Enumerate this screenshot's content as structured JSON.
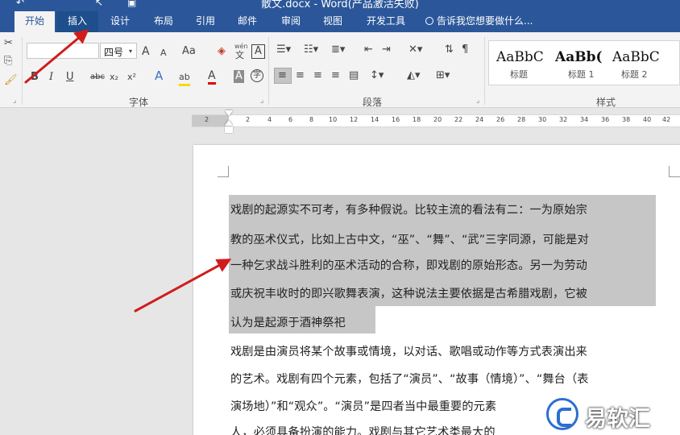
{
  "app": {
    "title": "散文.docx - Word(产品激活失败)"
  },
  "tabs": [
    {
      "label": "开始"
    },
    {
      "label": "插入"
    },
    {
      "label": "设计"
    },
    {
      "label": "布局"
    },
    {
      "label": "引用"
    },
    {
      "label": "邮件"
    },
    {
      "label": "审阅"
    },
    {
      "label": "视图"
    },
    {
      "label": "开发工具"
    }
  ],
  "tell_me": {
    "placeholder": "告诉我您想要做什么..."
  },
  "ribbon": {
    "font_size": "四号",
    "font_group_label": "字体",
    "paragraph_group_label": "段落",
    "styles_group_label": "样式",
    "phonetic_label_top": "wén",
    "phonetic_label_bottom": "文",
    "bold": "B",
    "italic": "I",
    "underline": "U",
    "strike": "abc",
    "subscript": "x₂",
    "superscript": "x²",
    "grow_font": "A",
    "shrink_font": "A",
    "change_case": "Aa",
    "border_char": "A",
    "effects": "A",
    "highlight": "ab",
    "font_color": "A",
    "shade_char": "A",
    "enclose_char": "字",
    "styles": [
      {
        "sample": "AaBbC",
        "name": "标题"
      },
      {
        "sample": "AaBb(",
        "name": "标题 1"
      },
      {
        "sample": "AaBbC",
        "name": "标题 2"
      }
    ]
  },
  "ruler": {
    "ticks": [
      "2",
      "2",
      "4",
      "6",
      "8",
      "10",
      "12",
      "14",
      "16",
      "18",
      "20",
      "22",
      "24",
      "26",
      "28",
      "30",
      "32",
      "34",
      "36",
      "38",
      "40",
      "42"
    ]
  },
  "document": {
    "selected_lines": [
      "戏剧的起源实不可考，有多种假说。比较主流的看法有二：一为原始宗",
      "教的巫术仪式，比如上古中文，“巫”、“舞”、“武”三字同源，可能是对",
      "一种乞求战斗胜利的巫术活动的合称，即戏剧的原始形态。另一为劳动",
      "或庆祝丰收时的即兴歌舞表演，这种说法主要依据是古希腊戏剧，它被",
      "认为是起源于酒神祭祀"
    ],
    "lines": [
      "戏剧是由演员将某个故事或情境，以对话、歌唱或动作等方式表演出来",
      "的艺术。戏剧有四个元素，包括了“演员”、“故事（情境）”、“舞台（表",
      "演场地）”和“观众”。“演员”是四者当中最重要的元素",
      "人，必须具备扮演的能力。戏剧与其它艺术类最大的"
    ]
  },
  "watermark": {
    "text": "易软汇"
  },
  "colors": {
    "accent": "#2b579a",
    "selection": "#c6c6c6",
    "arrow": "#d01c1c"
  }
}
